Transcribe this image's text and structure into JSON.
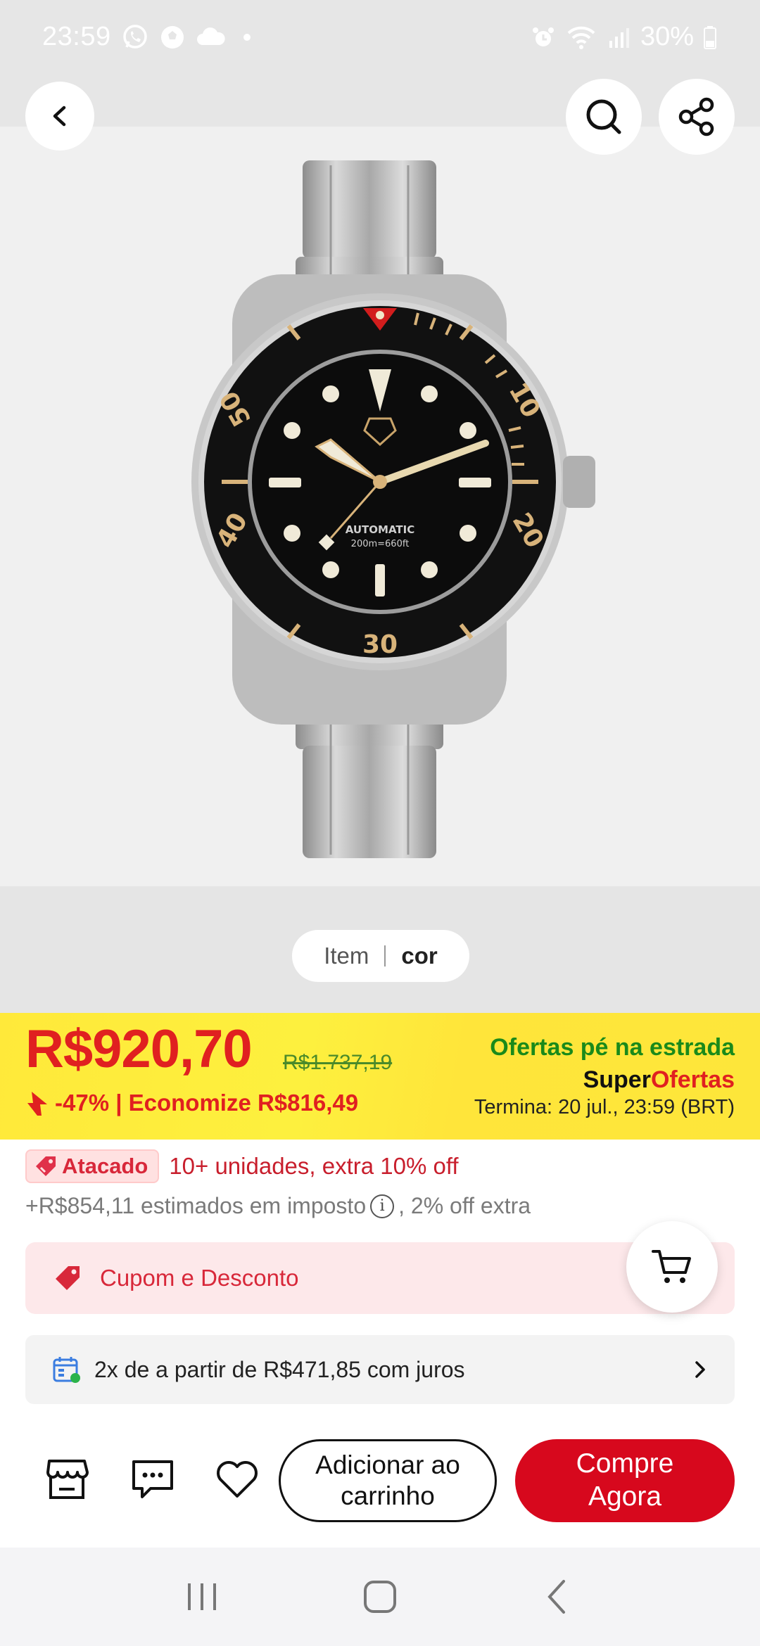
{
  "status_bar": {
    "time": "23:59",
    "battery": "30%",
    "left_icons": [
      "whatsapp-icon",
      "soccer-ball-icon",
      "cloud-icon",
      "dot-icon"
    ],
    "right_icons": [
      "alarm-icon",
      "wifi-icon",
      "signal-icon",
      "battery-icon"
    ]
  },
  "header": {
    "back_icon": "chevron-left-icon",
    "search_icon": "search-icon",
    "share_icon": "share-icon"
  },
  "product_image": {
    "dial_text": "AUTOMATIC",
    "dial_depth": "200m=660ft",
    "bezel_numbers": [
      "10",
      "20",
      "30",
      "40",
      "50"
    ]
  },
  "variant_selector": {
    "item_label": "Item",
    "selected_label": "cor"
  },
  "promo": {
    "price": "R$920,70",
    "original_price": "R$1.737,19",
    "discount": "-47% | Economize R$816,49",
    "campaign_title": "Ofertas pé na estrada",
    "brand_part1": "Super",
    "brand_part2": "Ofertas",
    "ends_label": "Termina:",
    "ends_value": "20 jul., 23:59 (BRT)",
    "colors": {
      "band": "#ffe93a",
      "price": "#e02020",
      "campaign": "#1a8a1a"
    }
  },
  "wholesale": {
    "badge": "Atacado",
    "text": "10+ unidades, extra 10% off"
  },
  "tax": {
    "before_icon": "+R$854,11 estimados em imposto",
    "info_symbol": "i",
    "after_icon": ", 2% off extra"
  },
  "coupon": {
    "label": "Cupom e Desconto"
  },
  "installments": {
    "text": "2x de a partir de R$471,85 com juros"
  },
  "actions": {
    "add_to_cart": "Adicionar ao carrinho",
    "buy_now": "Compre Agora",
    "buy_color": "#d7081d"
  }
}
